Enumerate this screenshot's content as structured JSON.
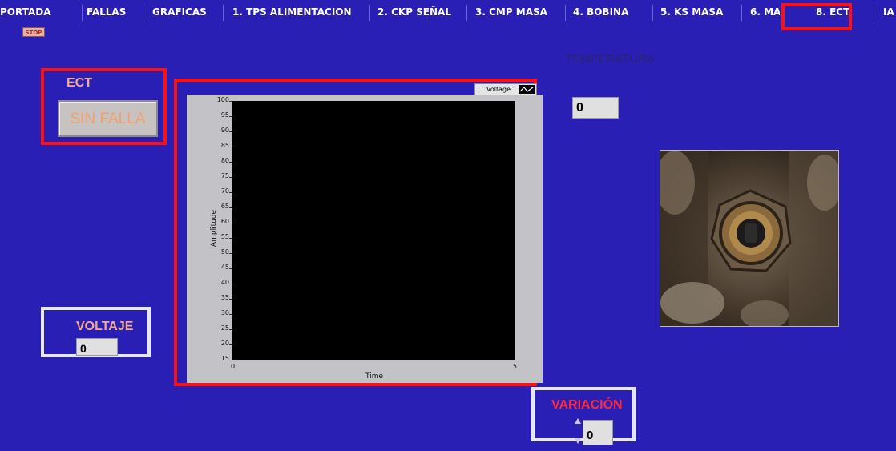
{
  "tabs": [
    {
      "label": "PORTADA"
    },
    {
      "label": "FALLAS"
    },
    {
      "label": "GRAFICAS"
    },
    {
      "label": "1. TPS ALIMENTACION"
    },
    {
      "label": "2. CKP SEÑAL"
    },
    {
      "label": "3. CMP MASA"
    },
    {
      "label": "4. BOBINA"
    },
    {
      "label": "5. KS MASA"
    },
    {
      "label": "6. MA"
    },
    {
      "label": "8. ECT",
      "active": true
    },
    {
      "label": "IA"
    }
  ],
  "stop_label": "STOP",
  "ect": {
    "label": "ECT",
    "status_button": "SIN FALLA"
  },
  "temperatura": {
    "label": "TEMPERATURA",
    "value": "0"
  },
  "voltaje": {
    "label": "VOLTAJE",
    "value": "0"
  },
  "variacion": {
    "label": "VARIACIÓN",
    "value": "0"
  },
  "graph": {
    "legend_name": "Voltage",
    "xlabel": "Time",
    "ylabel": "Amplitude",
    "yticks": [
      "100",
      "95",
      "90",
      "85",
      "80",
      "75",
      "70",
      "65",
      "60",
      "55",
      "50",
      "45",
      "40",
      "35",
      "30",
      "25",
      "20",
      "15"
    ],
    "xticks": [
      "0",
      "5"
    ]
  },
  "chart_data": {
    "type": "line",
    "series": [
      {
        "name": "Voltage",
        "values": []
      }
    ],
    "xlabel": "Time",
    "ylabel": "Amplitude",
    "xlim": [
      0,
      5
    ],
    "ylim": [
      15,
      100
    ],
    "yticks": [
      100,
      95,
      90,
      85,
      80,
      75,
      70,
      65,
      60,
      55,
      50,
      45,
      40,
      35,
      30,
      25,
      20,
      15
    ],
    "xticks": [
      0,
      5
    ],
    "grid": false,
    "legend": "top-right"
  },
  "colors": {
    "background": "#2a1fb4",
    "highlight_red": "#ff1010",
    "highlight_white": "#e8e8f0",
    "label_salmon": "#f3a98a",
    "variacion_red": "#ff2a3a",
    "plot_bg": "#000000"
  }
}
